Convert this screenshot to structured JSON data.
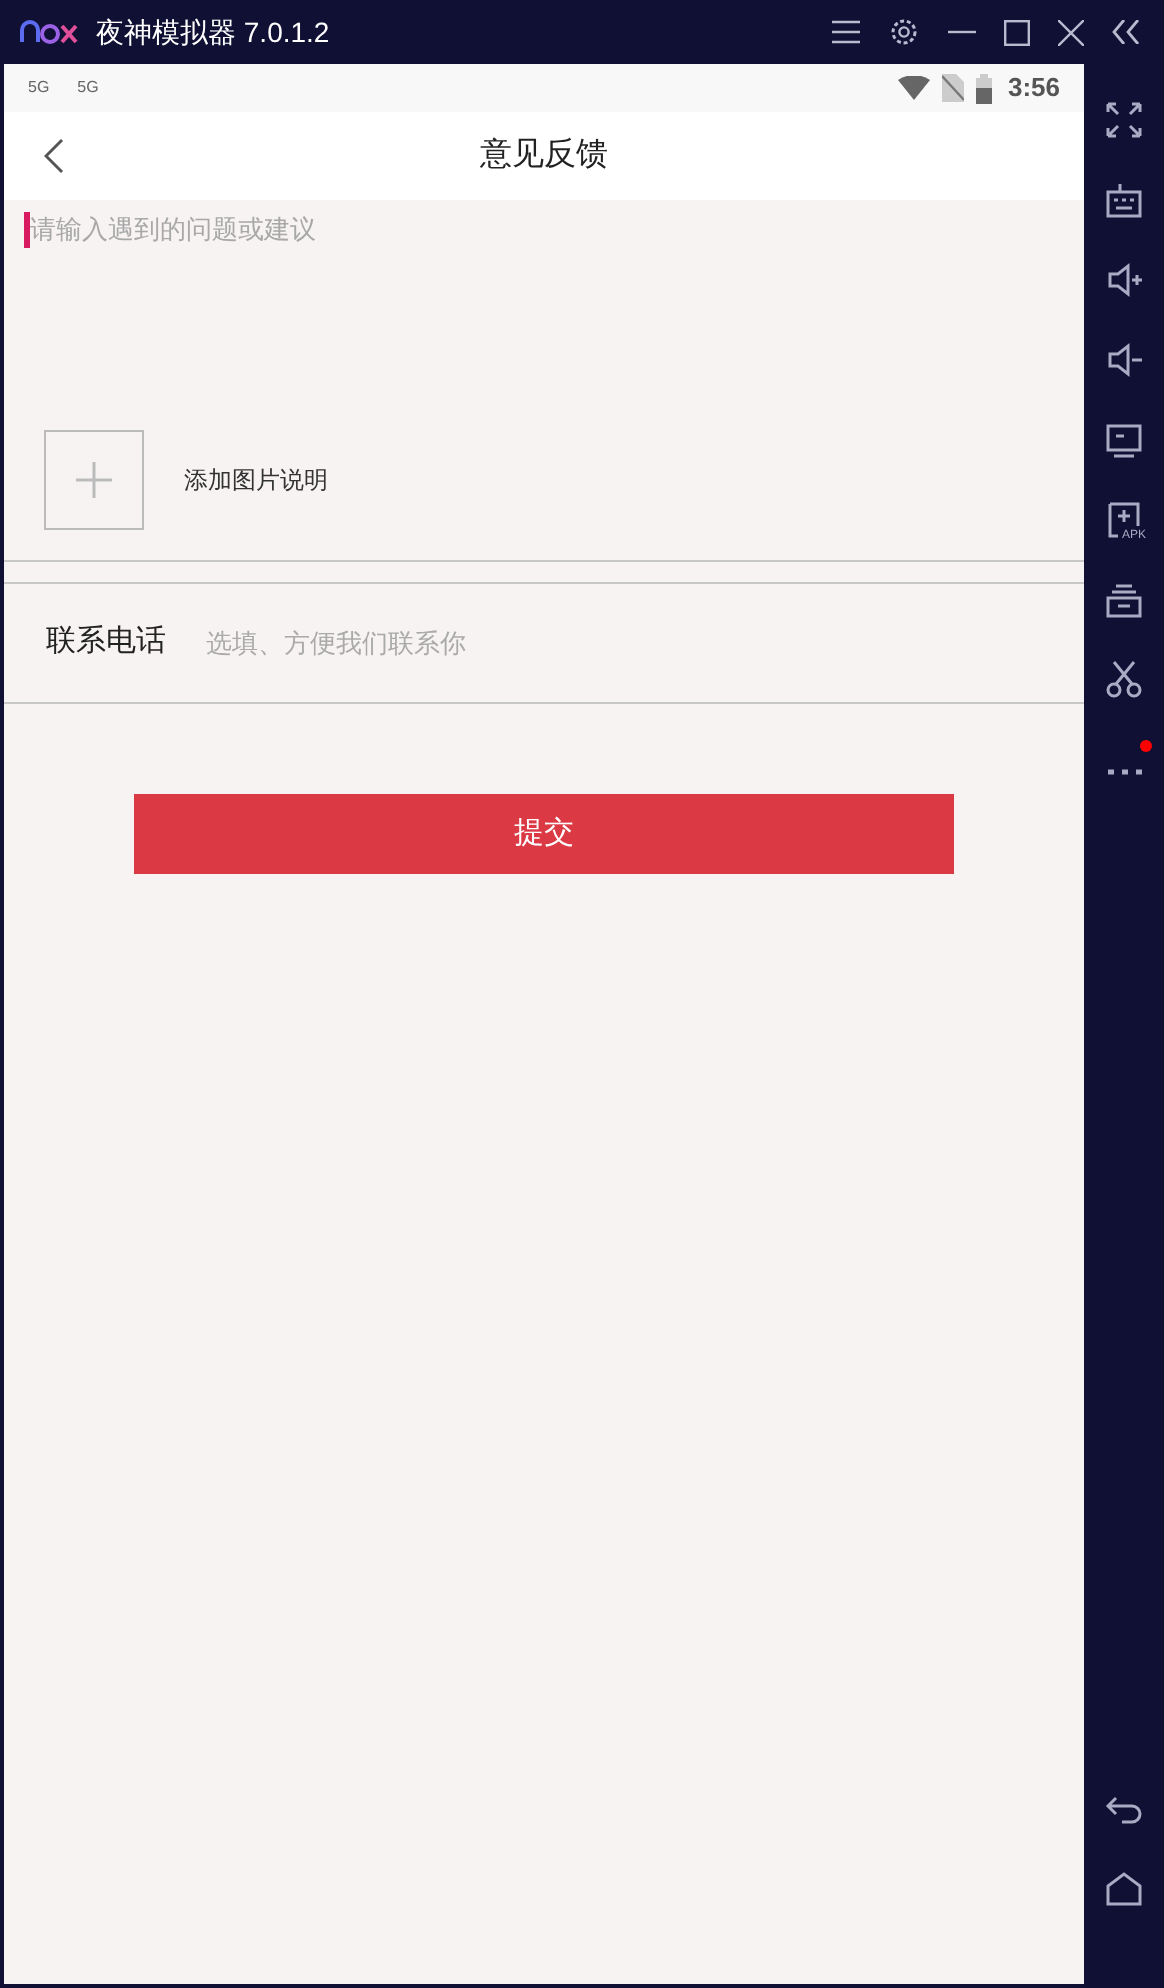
{
  "window": {
    "title": "夜神模拟器 7.0.1.2"
  },
  "status_bar": {
    "signals": [
      "5G",
      "5G"
    ],
    "time": "3:56"
  },
  "header": {
    "title": "意见反馈"
  },
  "feedback": {
    "placeholder": "请输入遇到的问题或建议"
  },
  "add_image": {
    "label": "添加图片说明"
  },
  "contact": {
    "label": "联系电话",
    "placeholder": "选填、方便我们联系你"
  },
  "submit": {
    "label": "提交"
  },
  "sidebar": {
    "items": [
      {
        "kind": "fullscreen",
        "badge": false
      },
      {
        "kind": "keyboard",
        "badge": false
      },
      {
        "kind": "volume-up",
        "badge": false
      },
      {
        "kind": "volume-down",
        "badge": false
      },
      {
        "kind": "screen",
        "badge": false
      },
      {
        "kind": "apk",
        "label": "APK",
        "badge": false
      },
      {
        "kind": "stack",
        "badge": false
      },
      {
        "kind": "scissors",
        "badge": false
      },
      {
        "kind": "more",
        "badge": true
      }
    ],
    "nav": [
      {
        "kind": "back"
      },
      {
        "kind": "home"
      }
    ]
  }
}
